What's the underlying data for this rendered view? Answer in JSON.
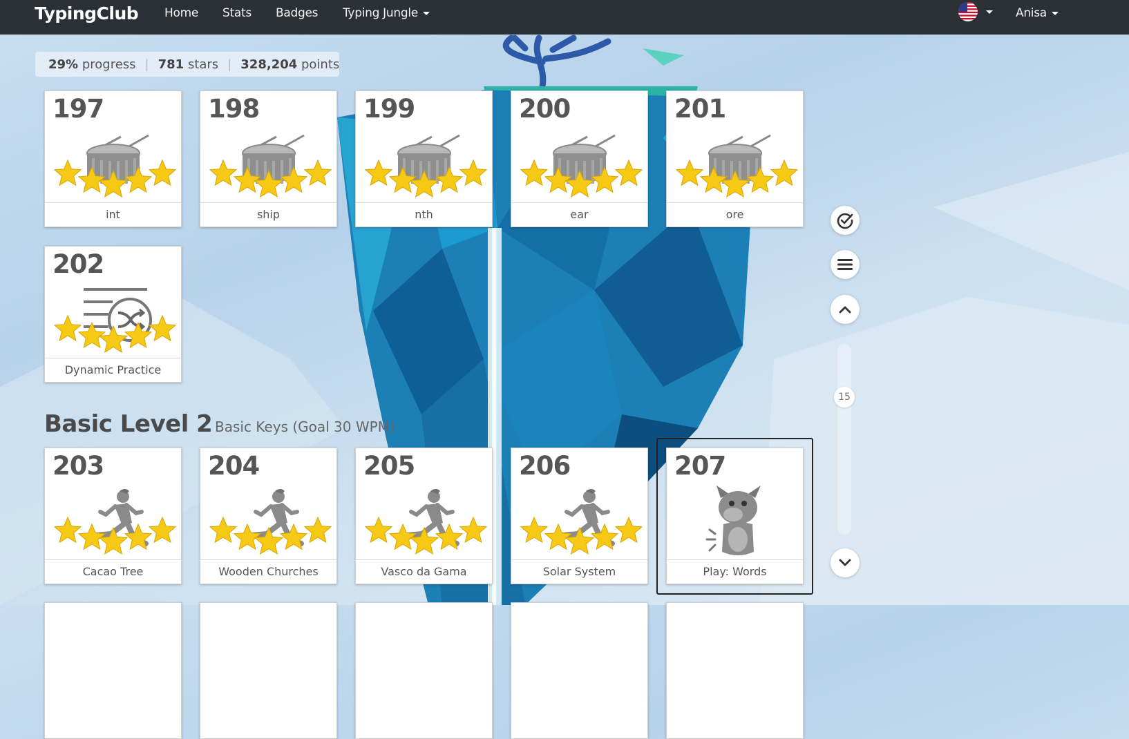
{
  "navbar": {
    "brand": "TypingClub",
    "home": "Home",
    "stats": "Stats",
    "badges": "Badges",
    "jungle": "Typing Jungle",
    "user": "Anisa"
  },
  "progress": {
    "percent": "29%",
    "percent_label": "progress",
    "stars": "781",
    "stars_label": "stars",
    "points": "328,204",
    "points_label": "points"
  },
  "lessons_top": [
    {
      "num": "197",
      "label": "int",
      "icon": "drum-icon"
    },
    {
      "num": "198",
      "label": "ship",
      "icon": "drum-icon"
    },
    {
      "num": "199",
      "label": "nth",
      "icon": "drum-icon"
    },
    {
      "num": "200",
      "label": "ear",
      "icon": "drum-icon"
    },
    {
      "num": "201",
      "label": "ore",
      "icon": "drum-icon"
    },
    {
      "num": "202",
      "label": "Dynamic Practice",
      "icon": "shuffle-list-icon"
    }
  ],
  "level": {
    "title": "Basic Level 2",
    "subtitle": "Basic Keys (Goal 30 WPM)"
  },
  "lessons_level2": [
    {
      "num": "203",
      "label": "Cacao Tree",
      "icon": "runner-icon"
    },
    {
      "num": "204",
      "label": "Wooden Churches",
      "icon": "runner-icon"
    },
    {
      "num": "205",
      "label": "Vasco da Gama",
      "icon": "runner-icon"
    },
    {
      "num": "206",
      "label": "Solar System",
      "icon": "runner-icon"
    },
    {
      "num": "207",
      "label": "Play: Words",
      "icon": "monster-icon"
    }
  ],
  "scroll": {
    "page": "15"
  },
  "colors": {
    "navbar": "#2b3036",
    "star": "#f5c518",
    "island": "#1e88b8"
  }
}
